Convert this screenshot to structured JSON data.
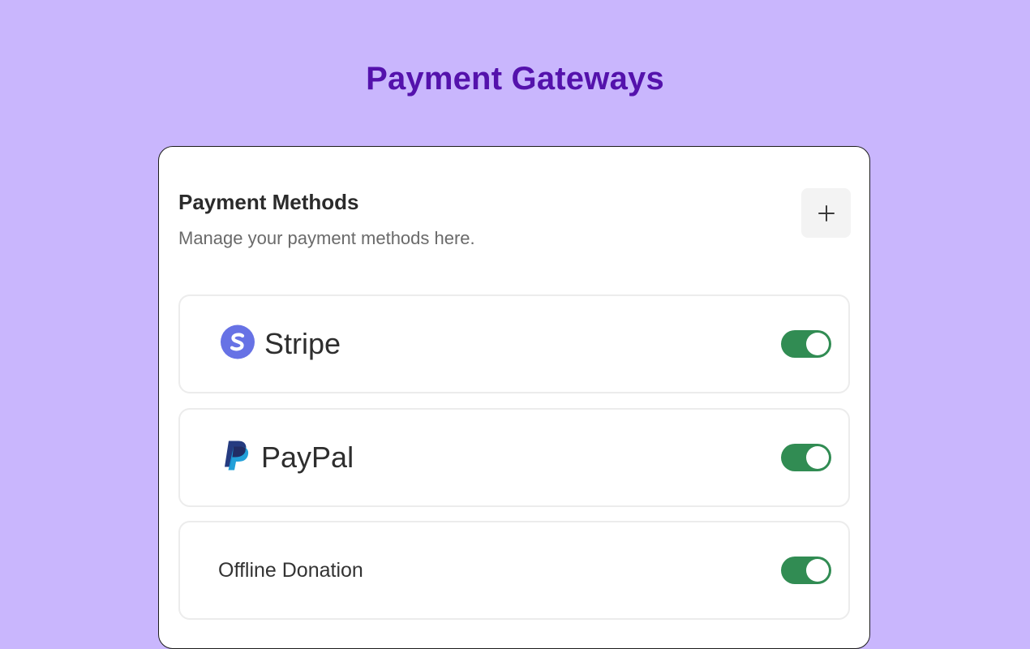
{
  "page": {
    "title": "Payment Gateways"
  },
  "card": {
    "title": "Payment Methods",
    "subtitle": "Manage your payment methods here.",
    "add_icon": "plus-icon"
  },
  "methods": [
    {
      "name": "Stripe",
      "icon": "stripe-logo",
      "enabled": true
    },
    {
      "name": "PayPal",
      "icon": "paypal-logo",
      "enabled": true
    },
    {
      "name": "Offline Donation",
      "icon": null,
      "enabled": true
    }
  ],
  "colors": {
    "background": "#c9b6fd",
    "title": "#5412ac",
    "toggle_on": "#318c53",
    "stripe": "#6772e5",
    "paypal_dark": "#253b80",
    "paypal_light": "#179bd7"
  }
}
